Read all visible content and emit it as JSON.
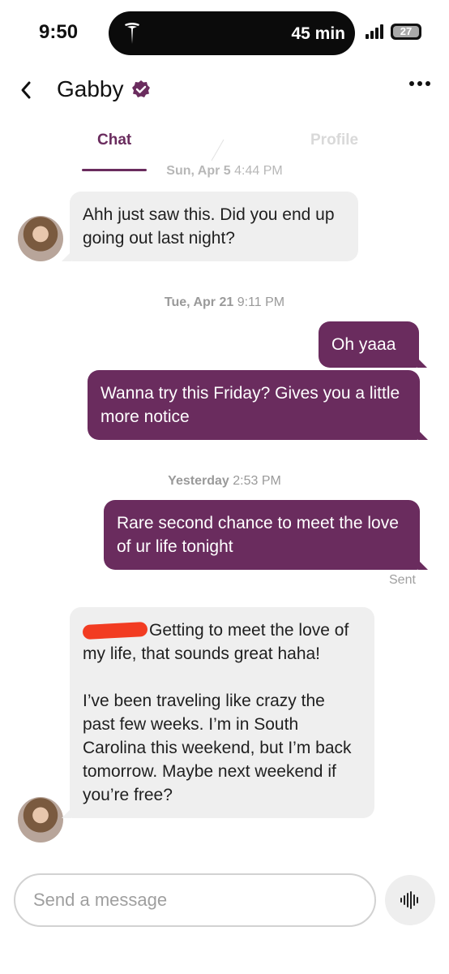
{
  "status_bar": {
    "time": "9:50",
    "trip_eta": "45 min",
    "battery": "27"
  },
  "header": {
    "contact_name": "Gabby",
    "verified": true
  },
  "tabs": [
    {
      "label": "Chat",
      "active": true
    },
    {
      "label": "Profile",
      "active": false
    }
  ],
  "messages": {
    "ts1": {
      "day": "Sun, Apr 5",
      "time": "4:44 PM"
    },
    "m1": "Ahh just saw this. Did you end up going out last night?",
    "ts2": {
      "day": "Tue, Apr 21",
      "time": "9:11 PM"
    },
    "m2": "Oh yaaa",
    "m3": "Wanna try this Friday? Gives you a little more notice",
    "ts3": {
      "day": "Yesterday",
      "time": "2:53 PM"
    },
    "m4": "Rare second chance to meet the love of ur life tonight",
    "m4_status": "Sent",
    "m5_part1": "Getting to meet the love of my life, that sounds great haha!",
    "m5_part2": "I’ve been traveling like crazy the past few weeks. I’m in South Carolina this weekend, but I’m back tomorrow. Maybe next weekend if you’re free?"
  },
  "composer": {
    "placeholder": "Send a message"
  },
  "colors": {
    "accent": "#6a2c5e",
    "incoming_bubble": "#efefef"
  },
  "icons": [
    "tesla-icon",
    "back-chevron-icon",
    "verified-badge-icon",
    "more-options-icon",
    "voice-waveform-icon"
  ]
}
